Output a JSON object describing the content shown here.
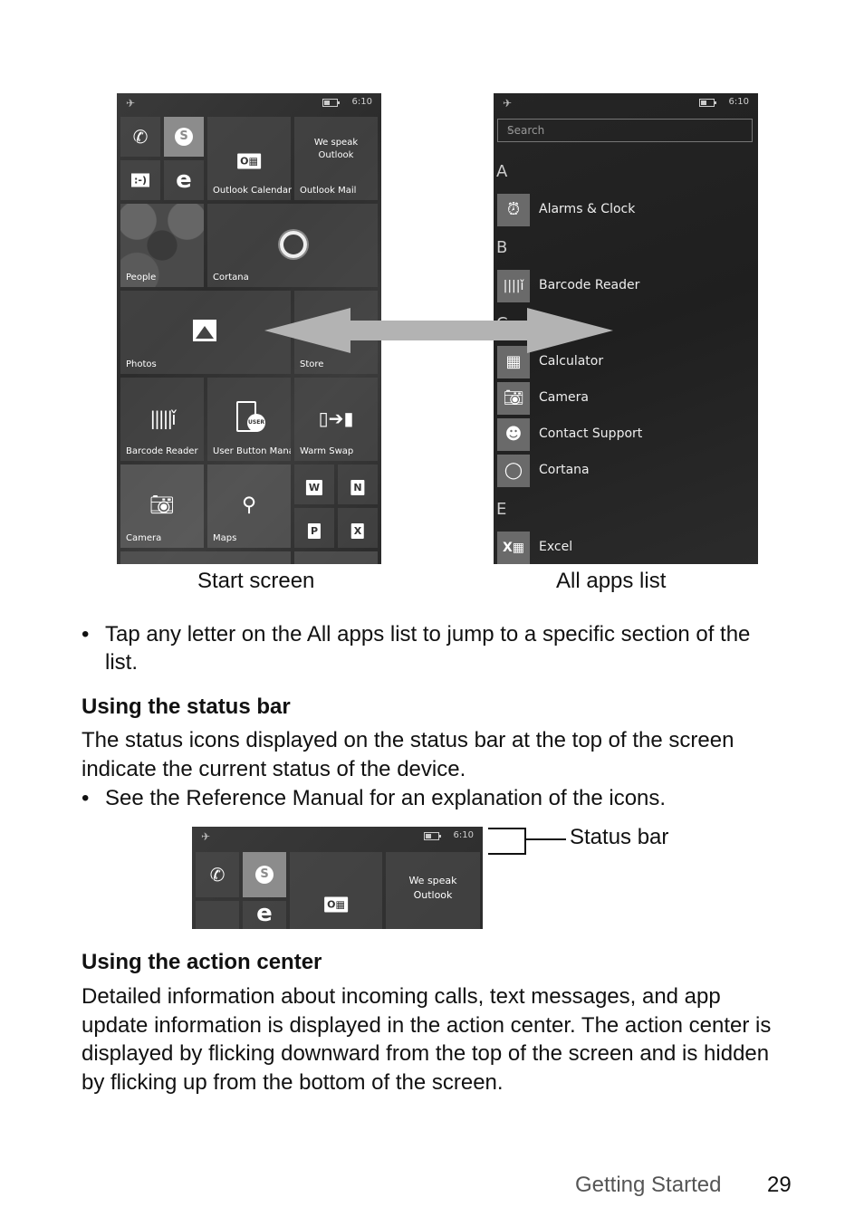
{
  "status_bar": {
    "time": "6:10",
    "airplane_icon": "airplane-icon",
    "battery_icon": "battery-icon"
  },
  "start_screen": {
    "caption": "Start screen",
    "tiles": {
      "phone": {
        "icon": "phone-icon"
      },
      "skype": {
        "icon": "skype-icon"
      },
      "messaging": {
        "icon": "messaging-icon"
      },
      "edge": {
        "icon": "edge-icon"
      },
      "outlook_calendar": {
        "label": "Outlook Calendar"
      },
      "outlook_mail": {
        "label": "Outlook Mail",
        "message": "We speak Outlook"
      },
      "people": {
        "label": "People"
      },
      "cortana": {
        "label": "Cortana"
      },
      "photos": {
        "label": "Photos"
      },
      "store": {
        "label": "Store"
      },
      "barcode_reader": {
        "label": "Barcode Reader"
      },
      "user_button_manager": {
        "label": "User Button Mana",
        "badge": "USER"
      },
      "warm_swap": {
        "label": "Warm Swap"
      },
      "word": {
        "glyph": "W"
      },
      "onenote": {
        "glyph": "N"
      },
      "powerpoint": {
        "glyph": "P"
      },
      "excel": {
        "glyph": "X"
      },
      "camera": {
        "label": "Camera"
      },
      "maps": {
        "label": "Maps"
      }
    }
  },
  "all_apps": {
    "caption": "All apps list",
    "search_placeholder": "Search",
    "sections": [
      {
        "letter": "A",
        "apps": [
          "Alarms & Clock"
        ]
      },
      {
        "letter": "B",
        "apps": [
          "Barcode Reader"
        ]
      },
      {
        "letter": "C",
        "apps": [
          "Calculator",
          "Camera",
          "Contact Support",
          "Cortana"
        ]
      },
      {
        "letter": "E",
        "apps": [
          "Excel"
        ]
      }
    ]
  },
  "doc": {
    "bullet1": "Tap any letter on the All apps list to jump to a specific section of the list.",
    "heading_status": "Using the status bar",
    "para_status": "The status icons displayed on the status bar at the top of the screen indicate the current status of the device.",
    "bullet2": "See the Reference Manual for an explanation of the icons.",
    "callout_status": "Status bar",
    "heading_action": "Using the action center",
    "para_action": "Detailed information about incoming calls, text messages, and app update information is displayed in the action center. The action center is displayed by flicking downward from the top of the screen and is hidden by flicking up from the bottom of the screen.",
    "bullet_char": "•"
  },
  "footer": {
    "section": "Getting Started",
    "page": "29"
  }
}
